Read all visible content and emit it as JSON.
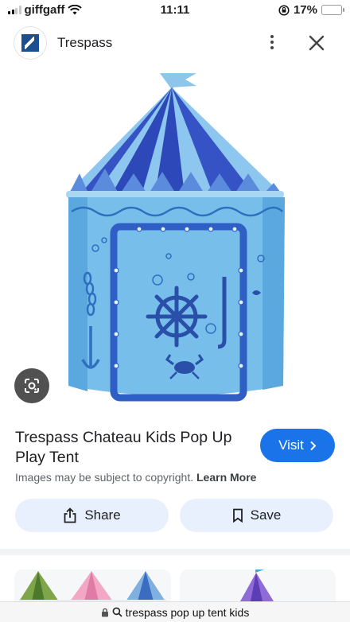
{
  "status": {
    "carrier": "giffgaff",
    "time": "11:11",
    "battery": "17%",
    "battery_level": 0.17
  },
  "header": {
    "site_name": "Trespass"
  },
  "result": {
    "title": "Trespass Chateau Kids Pop Up Play Tent",
    "visit_label": "Visit",
    "copyright_text": "Images may be subject to copyright.",
    "learn_more": "Learn More"
  },
  "actions": {
    "share_label": "Share",
    "save_label": "Save"
  },
  "url": {
    "text": "trespass pop up tent kids"
  },
  "colors": {
    "accent": "#1a73e8",
    "action_bg": "#e8f0fe",
    "battery_low": "#e0332b"
  }
}
